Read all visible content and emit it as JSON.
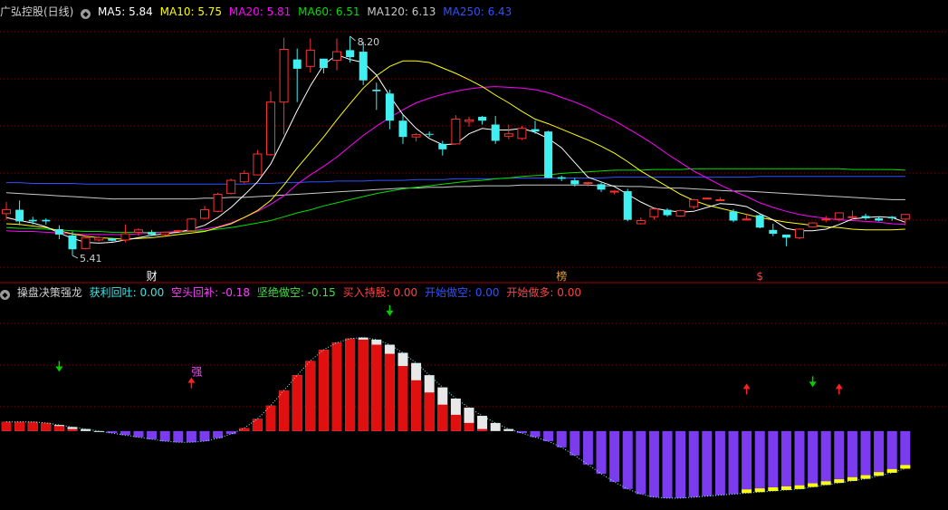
{
  "top_panel": {
    "title": "广弘控股(日线)",
    "indicators": [
      {
        "label": "MA5: 5.84",
        "color": "#ffffff"
      },
      {
        "label": "MA10: 5.75",
        "color": "#ffff00"
      },
      {
        "label": "MA20: 5.81",
        "color": "#ff00ff"
      },
      {
        "label": "MA60: 6.51",
        "color": "#00e000"
      },
      {
        "label": "MA120: 6.13",
        "color": "#c8c8c8"
      },
      {
        "label": "MA250: 6.43",
        "color": "#3050ff"
      }
    ]
  },
  "bottom_panel": {
    "title": "操盘决策强龙",
    "indicators": [
      {
        "label": "获利回吐: 0.00",
        "color": "#40e0e0"
      },
      {
        "label": "空头回补: -0.18",
        "color": "#ff40ff"
      },
      {
        "label": "坚绝做空: -0.15",
        "color": "#40e040"
      },
      {
        "label": "买入持股: 0.00",
        "color": "#ff4040"
      },
      {
        "label": "开始做空: 0.00",
        "color": "#3050ff"
      },
      {
        "label": "开始做多: 0.00",
        "color": "#ff4040"
      }
    ]
  },
  "colors": {
    "up": "#ff3030",
    "down": "#40f0f0",
    "ma5": "#ffffff",
    "ma10": "#ffff00",
    "ma20": "#ff00ff",
    "ma60": "#00e000",
    "ma120": "#c8c8c8",
    "ma250": "#3050ff",
    "grid": "#800000",
    "text": "#c0c0c0"
  },
  "chart_data": {
    "type": "candlestick",
    "y_range": [
      5.2,
      8.45
    ],
    "high_label": "8.20",
    "low_label": "5.41",
    "high_index": 26,
    "low_index": 5,
    "candles": [
      [
        5.95,
        6.0,
        6.1,
        5.87
      ],
      [
        6.0,
        5.85,
        6.12,
        5.8
      ],
      [
        5.87,
        5.85,
        5.91,
        5.81
      ],
      [
        5.87,
        5.85,
        5.89,
        5.81
      ],
      [
        5.75,
        5.68,
        5.8,
        5.62
      ],
      [
        5.67,
        5.49,
        5.72,
        5.41
      ],
      [
        5.5,
        5.64,
        5.66,
        5.49
      ],
      [
        5.61,
        5.64,
        5.66,
        5.59
      ],
      [
        5.63,
        5.6,
        5.64,
        5.59
      ],
      [
        5.61,
        5.69,
        5.81,
        5.58
      ],
      [
        5.71,
        5.74,
        5.76,
        5.66
      ],
      [
        5.71,
        5.68,
        5.74,
        5.66
      ],
      [
        5.68,
        5.71,
        5.72,
        5.67
      ],
      [
        5.73,
        5.73,
        5.74,
        5.72
      ],
      [
        5.73,
        5.88,
        5.89,
        5.72
      ],
      [
        5.89,
        6.0,
        6.05,
        5.88
      ],
      [
        5.98,
        6.2,
        6.22,
        5.97
      ],
      [
        6.21,
        6.38,
        6.4,
        6.2
      ],
      [
        6.36,
        6.47,
        6.51,
        6.34
      ],
      [
        6.45,
        6.72,
        6.77,
        6.45
      ],
      [
        6.71,
        7.39,
        7.53,
        6.7
      ],
      [
        7.39,
        8.07,
        8.22,
        6.97
      ],
      [
        7.94,
        7.82,
        8.08,
        7.39
      ],
      [
        7.85,
        8.06,
        8.21,
        7.77
      ],
      [
        7.95,
        7.83,
        7.88,
        7.76
      ],
      [
        7.93,
        8.04,
        8.21,
        7.8
      ],
      [
        8.06,
        7.97,
        8.24,
        7.9
      ],
      [
        8.04,
        7.67,
        8.17,
        7.61
      ],
      [
        7.55,
        7.53,
        7.64,
        7.29
      ],
      [
        7.5,
        7.15,
        7.55,
        7.04
      ],
      [
        7.15,
        6.94,
        7.23,
        6.85
      ],
      [
        6.94,
        6.97,
        6.99,
        6.88
      ],
      [
        6.98,
        6.97,
        7.01,
        6.94
      ],
      [
        6.85,
        6.78,
        6.89,
        6.7
      ],
      [
        6.85,
        7.17,
        7.22,
        6.84
      ],
      [
        7.14,
        7.16,
        7.2,
        7.07
      ],
      [
        7.2,
        7.15,
        7.21,
        7.1
      ],
      [
        7.1,
        6.89,
        7.21,
        6.85
      ],
      [
        6.95,
        6.98,
        7.1,
        6.91
      ],
      [
        6.92,
        7.05,
        7.08,
        6.9
      ],
      [
        7.04,
        7.01,
        7.15,
        6.98
      ],
      [
        7.01,
        6.41,
        7.02,
        6.41
      ],
      [
        6.42,
        6.4,
        6.44,
        6.37
      ],
      [
        6.38,
        6.33,
        6.41,
        6.3
      ],
      [
        6.34,
        6.35,
        6.36,
        6.3
      ],
      [
        6.33,
        6.26,
        6.35,
        6.23
      ],
      [
        6.23,
        6.24,
        6.25,
        6.2
      ],
      [
        6.24,
        5.87,
        6.27,
        5.85
      ],
      [
        5.82,
        5.86,
        5.9,
        5.81
      ],
      [
        5.91,
        6.01,
        6.02,
        5.87
      ],
      [
        6.0,
        5.93,
        6.02,
        5.91
      ],
      [
        5.92,
        5.99,
        6.0,
        5.91
      ],
      [
        6.04,
        6.13,
        6.14,
        6.01
      ],
      [
        6.15,
        6.15,
        6.16,
        6.14
      ],
      [
        6.13,
        6.13,
        6.16,
        6.13
      ],
      [
        5.98,
        5.86,
        6.01,
        5.84
      ],
      [
        5.88,
        5.88,
        5.94,
        5.87
      ],
      [
        5.93,
        5.77,
        5.95,
        5.76
      ],
      [
        5.74,
        5.69,
        5.82,
        5.66
      ],
      [
        5.68,
        5.64,
        5.68,
        5.53
      ],
      [
        5.64,
        5.75,
        5.76,
        5.62
      ],
      [
        5.78,
        5.83,
        5.84,
        5.77
      ],
      [
        5.87,
        5.88,
        5.92,
        5.84
      ],
      [
        5.88,
        5.96,
        5.96,
        5.85
      ],
      [
        5.9,
        5.91,
        5.99,
        5.88
      ],
      [
        5.92,
        5.89,
        5.95,
        5.87
      ],
      [
        5.89,
        5.86,
        5.91,
        5.85
      ],
      [
        5.91,
        5.89,
        5.92,
        5.86
      ],
      [
        5.88,
        5.94,
        5.94,
        5.8
      ]
    ],
    "ma250": [
      6.35,
      6.35,
      6.34,
      6.34,
      6.34,
      6.34,
      6.33,
      6.33,
      6.33,
      6.33,
      6.33,
      6.33,
      6.33,
      6.33,
      6.33,
      6.33,
      6.33,
      6.33,
      6.33,
      6.34,
      6.34,
      6.35,
      6.35,
      6.36,
      6.36,
      6.37,
      6.37,
      6.37,
      6.38,
      6.38,
      6.38,
      6.39,
      6.39,
      6.39,
      6.4,
      6.4,
      6.4,
      6.4,
      6.41,
      6.41,
      6.41,
      6.41,
      6.41,
      6.41,
      6.41,
      6.41,
      6.42,
      6.42,
      6.42,
      6.42,
      6.42,
      6.42,
      6.42,
      6.42,
      6.42,
      6.42,
      6.42,
      6.43,
      6.43,
      6.43,
      6.43,
      6.43,
      6.43,
      6.43,
      6.43,
      6.43,
      6.43,
      6.43,
      6.43
    ],
    "ma120": [
      6.22,
      6.21,
      6.2,
      6.19,
      6.18,
      6.17,
      6.16,
      6.15,
      6.14,
      6.14,
      6.14,
      6.14,
      6.14,
      6.14,
      6.14,
      6.15,
      6.15,
      6.16,
      6.16,
      6.17,
      6.18,
      6.19,
      6.2,
      6.21,
      6.22,
      6.23,
      6.24,
      6.25,
      6.26,
      6.27,
      6.28,
      6.28,
      6.29,
      6.29,
      6.3,
      6.3,
      6.31,
      6.31,
      6.31,
      6.32,
      6.32,
      6.32,
      6.32,
      6.32,
      6.32,
      6.31,
      6.31,
      6.3,
      6.3,
      6.29,
      6.28,
      6.28,
      6.27,
      6.26,
      6.25,
      6.24,
      6.24,
      6.23,
      6.22,
      6.21,
      6.2,
      6.19,
      6.18,
      6.17,
      6.16,
      6.15,
      6.14,
      6.13,
      6.13
    ],
    "ma60": [
      5.77,
      5.76,
      5.76,
      5.75,
      5.74,
      5.73,
      5.72,
      5.72,
      5.71,
      5.71,
      5.71,
      5.71,
      5.71,
      5.71,
      5.72,
      5.73,
      5.75,
      5.77,
      5.8,
      5.83,
      5.86,
      5.91,
      5.96,
      6.0,
      6.05,
      6.09,
      6.13,
      6.17,
      6.21,
      6.24,
      6.27,
      6.29,
      6.31,
      6.33,
      6.35,
      6.37,
      6.38,
      6.4,
      6.41,
      6.43,
      6.44,
      6.45,
      6.47,
      6.48,
      6.49,
      6.5,
      6.51,
      6.51,
      6.51,
      6.52,
      6.52,
      6.52,
      6.53,
      6.53,
      6.53,
      6.53,
      6.53,
      6.53,
      6.53,
      6.53,
      6.53,
      6.53,
      6.53,
      6.53,
      6.52,
      6.52,
      6.52,
      6.52,
      6.51
    ],
    "ma20": [
      5.73,
      5.72,
      5.72,
      5.71,
      5.7,
      5.69,
      5.68,
      5.68,
      5.68,
      5.68,
      5.69,
      5.7,
      5.71,
      5.72,
      5.73,
      5.75,
      5.78,
      5.83,
      5.9,
      5.98,
      6.07,
      6.18,
      6.33,
      6.45,
      6.56,
      6.68,
      6.82,
      6.96,
      7.08,
      7.19,
      7.29,
      7.38,
      7.44,
      7.49,
      7.53,
      7.56,
      7.58,
      7.59,
      7.58,
      7.57,
      7.55,
      7.51,
      7.45,
      7.39,
      7.32,
      7.23,
      7.15,
      7.05,
      6.95,
      6.84,
      6.72,
      6.61,
      6.5,
      6.41,
      6.32,
      6.24,
      6.17,
      6.09,
      6.03,
      5.98,
      5.94,
      5.91,
      5.89,
      5.87,
      5.86,
      5.85,
      5.84,
      5.82,
      5.81
    ],
    "ma10": [
      5.82,
      5.81,
      5.79,
      5.77,
      5.73,
      5.69,
      5.66,
      5.64,
      5.63,
      5.62,
      5.63,
      5.64,
      5.66,
      5.68,
      5.7,
      5.72,
      5.77,
      5.82,
      5.9,
      5.99,
      6.12,
      6.32,
      6.54,
      6.74,
      6.94,
      7.16,
      7.37,
      7.57,
      7.73,
      7.85,
      7.92,
      7.92,
      7.9,
      7.83,
      7.76,
      7.68,
      7.59,
      7.48,
      7.38,
      7.27,
      7.17,
      7.11,
      7.04,
      6.97,
      6.9,
      6.82,
      6.73,
      6.62,
      6.5,
      6.4,
      6.3,
      6.2,
      6.12,
      6.06,
      6.02,
      5.98,
      5.94,
      5.9,
      5.87,
      5.84,
      5.82,
      5.8,
      5.78,
      5.77,
      5.75,
      5.74,
      5.74,
      5.74,
      5.75
    ],
    "ma5": [
      5.9,
      5.86,
      5.83,
      5.78,
      5.7,
      5.63,
      5.58,
      5.57,
      5.58,
      5.61,
      5.64,
      5.67,
      5.69,
      5.71,
      5.75,
      5.8,
      5.9,
      6.03,
      6.19,
      6.36,
      6.59,
      6.93,
      7.28,
      7.6,
      7.87,
      8.0,
      7.94,
      7.9,
      7.74,
      7.47,
      7.23,
      7.05,
      6.92,
      6.84,
      6.85,
      6.98,
      7.05,
      7.03,
      7.03,
      7.05,
      7.0,
      6.92,
      6.8,
      6.61,
      6.42,
      6.36,
      6.3,
      6.2,
      6.1,
      6.02,
      5.99,
      5.97,
      5.98,
      6.03,
      6.08,
      6.07,
      6.04,
      5.95,
      5.87,
      5.76,
      5.73,
      5.73,
      5.75,
      5.81,
      5.88,
      5.9,
      5.91,
      5.9,
      5.84
    ],
    "markers": [
      {
        "index": 11,
        "label": "财",
        "color": "#ffffff"
      },
      {
        "index": 42,
        "label": "榜",
        "color": "#e0a040"
      },
      {
        "index": 57,
        "label": "$",
        "color": "#ff4040"
      }
    ]
  },
  "oscillator_data": {
    "type": "bar",
    "y_range": [
      -0.75,
      1.3
    ],
    "values": [
      0.09,
      0.09,
      0.09,
      0.08,
      0.06,
      0.04,
      0.02,
      0.0,
      -0.02,
      -0.04,
      -0.06,
      -0.08,
      -0.1,
      -0.11,
      -0.11,
      -0.1,
      -0.07,
      -0.03,
      0.03,
      0.12,
      0.25,
      0.4,
      0.55,
      0.69,
      0.8,
      0.87,
      0.91,
      0.92,
      0.9,
      0.85,
      0.77,
      0.67,
      0.55,
      0.43,
      0.32,
      0.23,
      0.15,
      0.08,
      0.02,
      -0.02,
      -0.06,
      -0.1,
      -0.16,
      -0.24,
      -0.33,
      -0.42,
      -0.5,
      -0.57,
      -0.62,
      -0.65,
      -0.66,
      -0.66,
      -0.65,
      -0.64,
      -0.63,
      -0.62,
      -0.61,
      -0.6,
      -0.59,
      -0.58,
      -0.57,
      -0.55,
      -0.53,
      -0.51,
      -0.49,
      -0.47,
      -0.44,
      -0.41,
      -0.37
    ],
    "red_top": [
      0.09,
      0.09,
      0.09,
      0.08,
      0.05,
      0.02,
      0.0,
      0.0,
      0.0,
      0.0,
      0.0,
      0.0,
      0.0,
      0.0,
      0.0,
      0.0,
      0.0,
      0.0,
      0.03,
      0.12,
      0.25,
      0.4,
      0.55,
      0.69,
      0.8,
      0.87,
      0.91,
      0.9,
      0.85,
      0.76,
      0.64,
      0.5,
      0.38,
      0.26,
      0.16,
      0.08,
      0.02,
      0.0,
      0.0,
      0.0,
      0.0,
      0.0,
      0.0,
      0.0,
      0.0,
      0.0,
      0.0,
      0.0,
      0.0,
      0.0,
      0.0,
      0.0,
      0.0,
      0.0,
      0.0,
      0.0,
      0.0,
      0.0,
      0.0,
      0.0,
      0.0,
      0.0,
      0.0,
      0.0,
      0.0,
      0.0,
      0.0,
      0.0,
      0.0
    ],
    "yellow": [
      0,
      0,
      0,
      0,
      0,
      0,
      0,
      0,
      0,
      0,
      0,
      0,
      0,
      0,
      0,
      0,
      0,
      0,
      0,
      0,
      0,
      0,
      0,
      0,
      0,
      0,
      0,
      0,
      0,
      0,
      0,
      0,
      0,
      0,
      0,
      0,
      0,
      0,
      0,
      0,
      0,
      0,
      0,
      0,
      0,
      0,
      0,
      0,
      0,
      0,
      0,
      0,
      0,
      0,
      0,
      0,
      -0.57,
      -0.57,
      -0.57,
      -0.57,
      -0.57,
      -0.57,
      -0.57,
      -0.56,
      -0.54,
      -0.51,
      -0.47,
      -0.43,
      -0.39
    ],
    "arrows": [
      {
        "index": 4,
        "dir": "down",
        "color": "#00d000",
        "level": 0.6
      },
      {
        "index": 14,
        "dir": "up",
        "color": "#ff2020",
        "level": 0.51,
        "text": "强"
      },
      {
        "index": 29,
        "dir": "down",
        "color": "#00d000",
        "level": 1.15
      },
      {
        "index": 56,
        "dir": "up",
        "color": "#ff2020",
        "level": 0.45
      },
      {
        "index": 61,
        "dir": "down",
        "color": "#00d000",
        "level": 0.45
      },
      {
        "index": 63,
        "dir": "up",
        "color": "#ff2020",
        "level": 0.45
      }
    ]
  }
}
